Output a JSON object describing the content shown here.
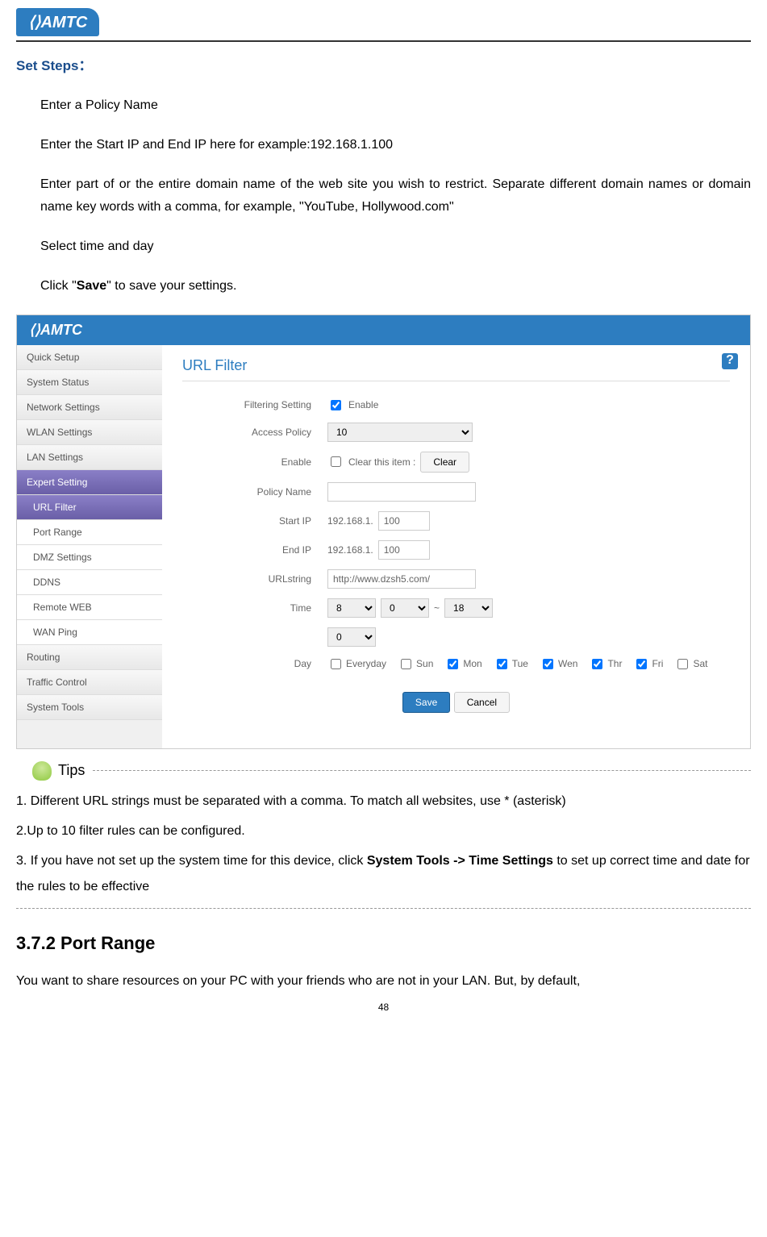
{
  "logo_text": "AMTC",
  "section_title": "Set Steps：",
  "steps": [
    "Enter a Policy Name",
    "Enter the Start IP and End IP here for example:192.168.1.100",
    "Enter part of or the entire domain name of the web site you wish to restrict. Separate different domain names or domain name key words with a comma, for example, \"YouTube, Hollywood.com\"",
    "Select time and day"
  ],
  "step5_prefix": "Click \"",
  "step5_bold": "Save",
  "step5_suffix": "\" to save your settings.",
  "screenshot": {
    "header_logo": "AMTC",
    "help": "?",
    "sidebar": [
      "Quick Setup",
      "System Status",
      "Network Settings",
      "WLAN Settings",
      "LAN Settings",
      "Expert Setting",
      "URL Filter",
      "Port Range",
      "DMZ Settings",
      "DDNS",
      "Remote WEB",
      "WAN Ping",
      "Routing",
      "Traffic Control",
      "System Tools"
    ],
    "panel_title": "URL Filter",
    "form": {
      "filtering_label": "Filtering Setting",
      "filtering_enable": "Enable",
      "access_policy_label": "Access Policy",
      "access_policy_value": "10",
      "enable_label": "Enable",
      "clear_item_text": "Clear this item :",
      "clear_btn": "Clear",
      "policy_name_label": "Policy Name",
      "start_ip_label": "Start IP",
      "ip_prefix": "192.168.1.",
      "start_ip_value": "100",
      "end_ip_label": "End IP",
      "end_ip_value": "100",
      "url_string_label": "URLstring",
      "url_string_value": "http://www.dzsh5.com/",
      "time_label": "Time",
      "time_values": [
        "8",
        "0",
        "18",
        "0"
      ],
      "time_sep": "~",
      "day_label": "Day",
      "days": [
        "Everyday",
        "Sun",
        "Mon",
        "Tue",
        "Wen",
        "Thr",
        "Fri",
        "Sat"
      ],
      "days_checked": [
        false,
        false,
        true,
        true,
        true,
        true,
        true,
        false
      ],
      "save_btn": "Save",
      "cancel_btn": "Cancel"
    }
  },
  "tips_label": "Tips",
  "tip1": "1. Different URL strings must be separated with a comma. To match all websites, use * (asterisk)",
  "tip2": "2.Up to 10 filter rules can be configured.",
  "tip3_prefix": "3. If you have not set up the system time for this device, click ",
  "tip3_bold": "System Tools -> Time Settings",
  "tip3_suffix": " to set up correct time and date for the rules to be effective",
  "subsection": "3.7.2 Port Range",
  "body_paragraph": "You want to share resources on your PC with your friends who are not in your LAN. But, by default,",
  "page_number": "48"
}
